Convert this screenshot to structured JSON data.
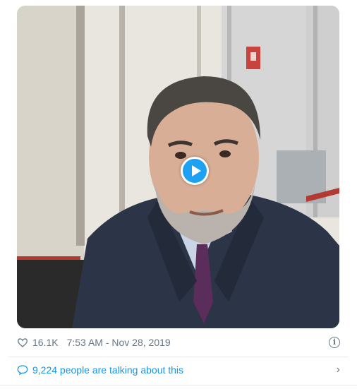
{
  "tweet": {
    "video": {
      "play_icon": "play-icon"
    },
    "meta": {
      "like_icon": "heart-icon",
      "like_count": "16.1K",
      "timestamp": "7:53 AM - Nov 28, 2019",
      "info_icon": "info-icon",
      "info_glyph": "i"
    },
    "conversation": {
      "icon": "speech-bubble-icon",
      "text": "9,224 people are talking about this",
      "chevron_icon": "chevron-right-icon",
      "chevron_glyph": "›"
    }
  },
  "colors": {
    "accent": "#1da1f2",
    "link": "#1b95e0",
    "muted": "#657786"
  }
}
